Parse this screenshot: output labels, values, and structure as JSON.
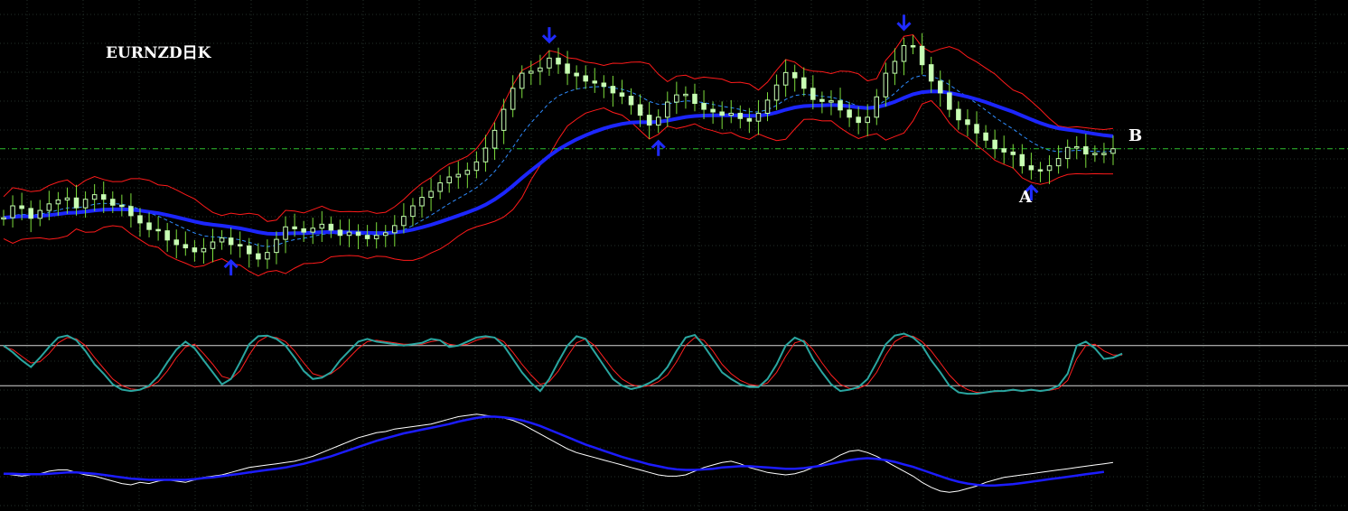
{
  "title": "EURNZD日K",
  "colors": {
    "background": "#000000",
    "grid": "#23312a",
    "candle": "#c8ffb4",
    "wick": "#7bdc3c",
    "slow_ma": "#1c26ff",
    "fast_ma": "#2f8cff",
    "band": "#ff1a1a",
    "hline": "#2fbf2f",
    "stoch_main": "#2aa6a0",
    "stoch_signal": "#ff2020",
    "stoch_levels": "#d8d8d8",
    "macd_main": "#ffffff",
    "macd_signal": "#1c1cff",
    "arrow": "#1f2bff"
  },
  "annotations": [
    {
      "text": "A",
      "anchor": "bottom-arrow-right"
    },
    {
      "text": "B",
      "anchor": "last-bar"
    }
  ],
  "arrows": [
    {
      "bar": 25,
      "dir": "up"
    },
    {
      "bar": 60,
      "dir": "down"
    },
    {
      "bar": 72,
      "dir": "up"
    },
    {
      "bar": 99,
      "dir": "down"
    },
    {
      "bar": 113,
      "dir": "up"
    }
  ],
  "chart_data": [
    {
      "type": "candlestick",
      "panel": "price",
      "series": [
        {
          "name": "candles",
          "values": [
            33.6,
            35.4,
            35.0,
            33.5,
            34.7,
            35.7,
            36.3,
            36.6,
            35.1,
            36.4,
            37.1,
            36.4,
            35.5,
            35.3,
            33.9,
            32.8,
            31.8,
            31.6,
            30.2,
            29.5,
            29.0,
            28.4,
            28.9,
            29.9,
            30.5,
            29.5,
            29.3,
            28.1,
            27.3,
            28.3,
            30.3,
            32.2,
            31.9,
            31.4,
            32.0,
            32.6,
            31.7,
            30.9,
            31.4,
            30.9,
            30.4,
            30.9,
            31.3,
            32.4,
            33.8,
            35.4,
            36.7,
            37.6,
            38.9,
            39.8,
            40.2,
            40.8,
            42.1,
            44.2,
            46.9,
            50.1,
            53.3,
            55.6,
            55.9,
            56.4,
            57.9,
            57.0,
            55.6,
            55.2,
            54.4,
            54.1,
            53.6,
            52.6,
            52.1,
            50.8,
            49.2,
            47.7,
            48.9,
            51.2,
            52.3,
            52.4,
            51.0,
            50.1,
            49.7,
            49.2,
            49.5,
            48.7,
            48.3,
            49.5,
            51.5,
            53.8,
            55.7,
            54.9,
            53.3,
            51.6,
            51.3,
            51.4,
            50.0,
            48.9,
            48.1,
            48.9,
            52.0,
            55.6,
            57.4,
            59.8,
            59.7,
            56.9,
            54.4,
            52.6,
            50.1,
            48.5,
            47.8,
            46.5,
            45.4,
            44.1,
            43.6,
            43.2,
            41.5,
            40.9,
            40.8,
            41.5,
            42.6,
            44.3,
            44.4,
            43.3,
            43.4,
            43.4,
            44.1
          ]
        }
      ],
      "moving_averages": [
        "slow_ma",
        "fast_ma",
        "band_upper",
        "band_lower"
      ],
      "horizontal_line": "dash-dot"
    },
    {
      "type": "line",
      "panel": "stochastic",
      "series": [
        {
          "name": "main",
          "values": [
            80,
            70,
            58,
            48,
            62,
            78,
            92,
            95,
            88,
            72,
            52,
            38,
            22,
            14,
            12,
            14,
            20,
            34,
            55,
            74,
            86,
            76,
            58,
            40,
            22,
            30,
            55,
            82,
            94,
            95,
            90,
            80,
            62,
            42,
            30,
            32,
            40,
            58,
            72,
            86,
            90,
            86,
            84,
            82,
            80,
            82,
            84,
            90,
            88,
            78,
            80,
            86,
            92,
            94,
            92,
            80,
            60,
            40,
            24,
            12,
            30,
            56,
            80,
            94,
            90,
            70,
            50,
            30,
            20,
            15,
            18,
            24,
            32,
            48,
            72,
            92,
            96,
            80,
            60,
            40,
            30,
            22,
            18,
            18,
            30,
            52,
            80,
            92,
            86,
            60,
            40,
            22,
            12,
            14,
            18,
            30,
            55,
            82,
            95,
            98,
            92,
            80,
            58,
            40,
            20,
            10,
            8,
            8,
            10,
            12,
            12,
            14,
            12,
            14,
            12,
            14,
            20,
            38,
            80,
            86,
            76,
            60,
            62,
            68
          ]
        },
        {
          "name": "signal",
          "values": [
            78,
            74,
            64,
            54,
            56,
            68,
            84,
            92,
            90,
            80,
            62,
            46,
            30,
            20,
            15,
            14,
            18,
            26,
            42,
            62,
            78,
            82,
            68,
            52,
            34,
            30,
            42,
            66,
            86,
            94,
            92,
            86,
            72,
            54,
            38,
            34,
            38,
            48,
            62,
            76,
            86,
            88,
            86,
            84,
            82,
            82,
            82,
            86,
            88,
            82,
            80,
            82,
            88,
            92,
            92,
            86,
            70,
            52,
            36,
            22,
            26,
            42,
            64,
            84,
            90,
            80,
            62,
            44,
            30,
            22,
            18,
            20,
            26,
            36,
            56,
            80,
            92,
            88,
            72,
            52,
            38,
            28,
            22,
            20,
            24,
            40,
            64,
            84,
            88,
            74,
            54,
            36,
            22,
            16,
            16,
            22,
            40,
            66,
            86,
            94,
            94,
            86,
            72,
            54,
            36,
            22,
            14,
            10,
            10,
            11,
            12,
            13,
            13,
            13,
            13,
            13,
            16,
            28,
            60,
            80,
            82,
            72,
            66,
            66
          ]
        }
      ],
      "levels": [
        80,
        20
      ]
    },
    {
      "type": "line",
      "panel": "macd",
      "series": [
        {
          "name": "main",
          "values": [
            0,
            -2,
            -4,
            -2,
            0,
            4,
            6,
            6,
            2,
            -2,
            -4,
            -8,
            -12,
            -16,
            -18,
            -14,
            -16,
            -12,
            -10,
            -12,
            -14,
            -10,
            -6,
            -4,
            -2,
            2,
            6,
            10,
            12,
            14,
            16,
            18,
            20,
            24,
            28,
            34,
            40,
            46,
            52,
            58,
            62,
            66,
            68,
            72,
            74,
            76,
            78,
            80,
            84,
            88,
            92,
            94,
            96,
            94,
            92,
            90,
            86,
            80,
            72,
            64,
            56,
            48,
            40,
            34,
            30,
            26,
            22,
            18,
            14,
            10,
            6,
            2,
            -2,
            -4,
            -4,
            -2,
            4,
            10,
            14,
            18,
            20,
            16,
            10,
            6,
            2,
            0,
            -2,
            0,
            4,
            10,
            16,
            22,
            30,
            36,
            38,
            34,
            28,
            20,
            12,
            4,
            -4,
            -14,
            -22,
            -28,
            -30,
            -28,
            -24,
            -20,
            -14,
            -10,
            -6,
            -4,
            -2,
            0,
            2,
            4,
            6,
            8,
            10,
            12,
            14,
            16,
            18
          ]
        },
        {
          "name": "signal",
          "values": [
            0,
            0,
            -1,
            -1,
            -1,
            0,
            1,
            2,
            2,
            1,
            0,
            -2,
            -4,
            -6,
            -8,
            -9,
            -10,
            -10,
            -10,
            -10,
            -10,
            -9,
            -7,
            -6,
            -4,
            -2,
            0,
            2,
            4,
            6,
            8,
            10,
            13,
            16,
            20,
            24,
            28,
            33,
            38,
            43,
            48,
            53,
            57,
            61,
            65,
            68,
            71,
            74,
            77,
            80,
            84,
            87,
            90,
            92,
            92,
            91,
            89,
            86,
            82,
            77,
            71,
            65,
            59,
            53,
            47,
            42,
            37,
            32,
            27,
            23,
            19,
            15,
            12,
            9,
            7,
            6,
            6,
            7,
            8,
            10,
            11,
            12,
            12,
            11,
            10,
            9,
            8,
            8,
            9,
            11,
            13,
            16,
            19,
            22,
            24,
            25,
            24,
            22,
            19,
            15,
            11,
            6,
            1,
            -4,
            -9,
            -13,
            -16,
            -18,
            -19,
            -19,
            -18,
            -17,
            -15,
            -13,
            -11,
            -9,
            -7,
            -5,
            -3,
            -1,
            1,
            3
          ]
        }
      ]
    }
  ]
}
